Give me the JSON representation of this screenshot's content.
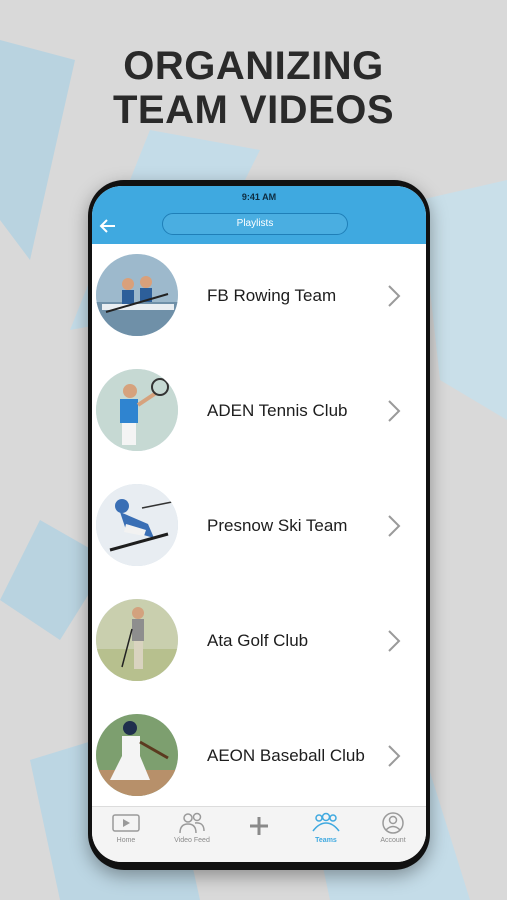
{
  "headline": {
    "line1": "ORGANIZING",
    "line2": "TEAM VIDEOS"
  },
  "phone": {
    "status_time": "9:41 AM",
    "header_title": "Playlists",
    "back_icon": "arrow-left-icon",
    "accent_color": "#3fa9e0"
  },
  "teams": [
    {
      "name": "FB Rowing Team",
      "sport_icon": "rowing-photo"
    },
    {
      "name": "ADEN Tennis Club",
      "sport_icon": "tennis-photo"
    },
    {
      "name": "Presnow Ski Team",
      "sport_icon": "ski-photo"
    },
    {
      "name": "Ata Golf Club",
      "sport_icon": "golf-photo"
    },
    {
      "name": "AEON Baseball Club",
      "sport_icon": "baseball-photo"
    }
  ],
  "tabbar": {
    "tabs": [
      {
        "label": "Home",
        "icon": "home-video-icon"
      },
      {
        "label": "Video Feed",
        "icon": "people-icon"
      },
      {
        "label": "",
        "icon": "plus-icon"
      },
      {
        "label": "Teams",
        "icon": "team-icon",
        "active": true
      },
      {
        "label": "Account",
        "icon": "account-icon"
      }
    ]
  }
}
